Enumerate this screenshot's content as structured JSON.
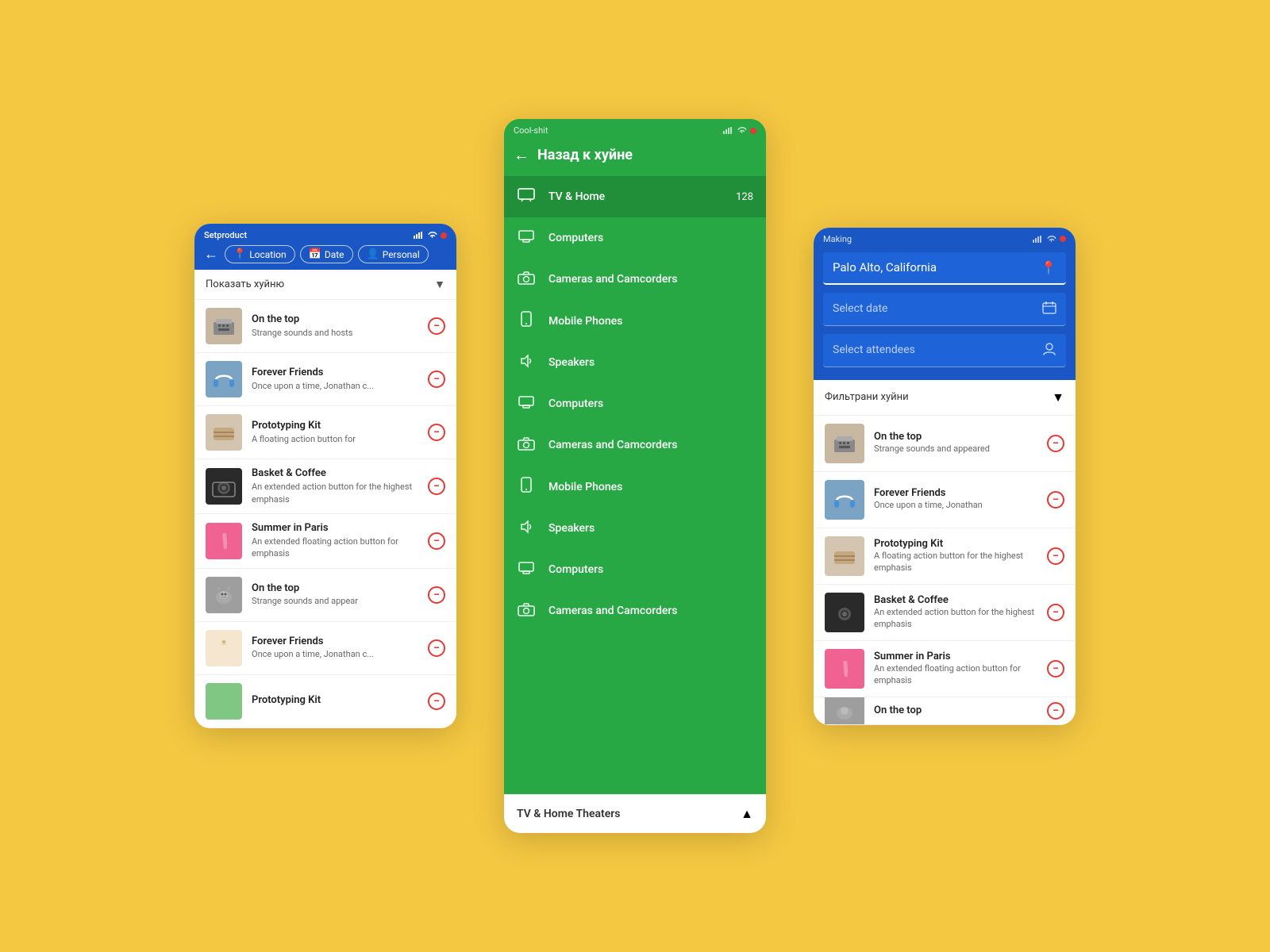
{
  "background": "#F5C842",
  "phone1": {
    "statusBar": {
      "appName": "Setproduct",
      "icons": [
        "signal",
        "wifi",
        "dot"
      ]
    },
    "nav": {
      "backIcon": "←",
      "chips": [
        {
          "icon": "📍",
          "label": "Location"
        },
        {
          "icon": "📅",
          "label": "Date"
        },
        {
          "icon": "👤",
          "label": "Personal"
        }
      ]
    },
    "filterBar": {
      "text": "Показать хуйню",
      "dropdownIcon": "▼"
    },
    "items": [
      {
        "title": "On the top",
        "subtitle": "Strange sounds and hosts",
        "img": "typewriter"
      },
      {
        "title": "Forever Friends",
        "subtitle": "Once upon a time, Jonathan c...",
        "img": "headphones"
      },
      {
        "title": "Prototyping Kit",
        "subtitle": "A floating action button for",
        "img": "knit"
      },
      {
        "title": "Basket & Coffee",
        "subtitle": "An extended action button for the highest emphasis",
        "img": "camera"
      },
      {
        "title": "Summer in Paris",
        "subtitle": "An extended floating action button for emphasis",
        "img": "clothespins"
      },
      {
        "title": "On the top",
        "subtitle": "Strange sounds and appear",
        "img": "cat"
      },
      {
        "title": "Forever Friends",
        "subtitle": "Once upon a time, Jonathan c...",
        "img": "perfume"
      },
      {
        "title": "Prototyping Kit",
        "subtitle": "",
        "img": "green"
      }
    ]
  },
  "phone2": {
    "statusBar": {
      "appName": "Cool-shit",
      "icons": [
        "signal",
        "wifi",
        "dot"
      ]
    },
    "nav": {
      "backIcon": "←",
      "title": "Назад к хуйне"
    },
    "categories": [
      {
        "icon": "tv",
        "label": "TV & Home",
        "count": "128",
        "active": true
      },
      {
        "icon": "computer",
        "label": "Computers",
        "count": "",
        "active": false
      },
      {
        "icon": "camera",
        "label": "Cameras and Camcorders",
        "count": "",
        "active": false
      },
      {
        "icon": "phone",
        "label": "Mobile Phones",
        "count": "",
        "active": false
      },
      {
        "icon": "music",
        "label": "Speakers",
        "count": "",
        "active": false
      },
      {
        "icon": "computer",
        "label": "Computers",
        "count": "",
        "active": false
      },
      {
        "icon": "camera",
        "label": "Cameras and Camcorders",
        "count": "",
        "active": false
      },
      {
        "icon": "phone",
        "label": "Mobile Phones",
        "count": "",
        "active": false
      },
      {
        "icon": "music",
        "label": "Speakers",
        "count": "",
        "active": false
      },
      {
        "icon": "computer",
        "label": "Computers",
        "count": "",
        "active": false
      },
      {
        "icon": "camera",
        "label": "Cameras and Camcorders",
        "count": "",
        "active": false
      }
    ],
    "bottomBar": {
      "label": "TV & Home Theaters",
      "icon": "▲"
    }
  },
  "phone3": {
    "statusBar": {
      "appName": "Making",
      "icons": [
        "signal",
        "wifi",
        "dot"
      ]
    },
    "searchField": {
      "value": "Palo Alto, California",
      "icon": "📍"
    },
    "dateField": {
      "placeholder": "Select date",
      "icon": "📅"
    },
    "attendeesField": {
      "placeholder": "Select attendees",
      "icon": "👤"
    },
    "filterBar": {
      "text": "Фильтрани хуйни",
      "dropdownIcon": "▼"
    },
    "items": [
      {
        "title": "On the top",
        "subtitle": "Strange sounds and appeared",
        "img": "typewriter"
      },
      {
        "title": "Forever Friends",
        "subtitle": "Once upon a time, Jonathan",
        "img": "headphones"
      },
      {
        "title": "Prototyping Kit",
        "subtitle": "A floating action button for the highest emphasis",
        "img": "knit"
      },
      {
        "title": "Basket & Coffee",
        "subtitle": "An extended action button for the highest emphasis",
        "img": "camera"
      },
      {
        "title": "Summer in Paris",
        "subtitle": "An extended floating action button for emphasis",
        "img": "clothespins"
      },
      {
        "title": "On the top",
        "subtitle": "",
        "img": "cat"
      }
    ]
  }
}
